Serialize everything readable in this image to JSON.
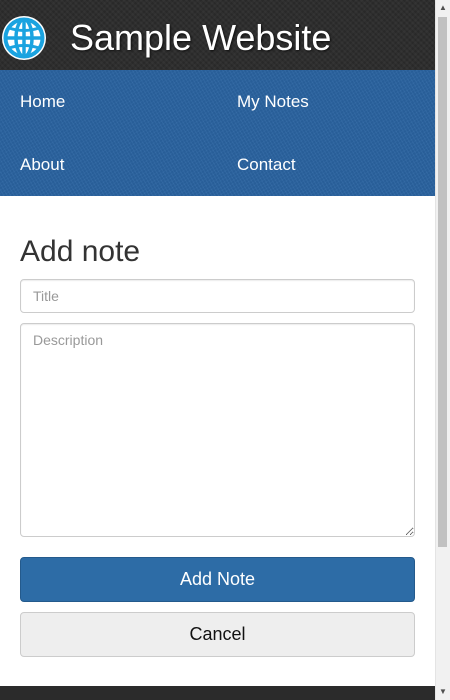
{
  "header": {
    "title": "Sample Website",
    "logo_icon": "globe-icon",
    "logo_color": "#1aa3e0"
  },
  "nav": {
    "items": [
      {
        "label": "Home"
      },
      {
        "label": "My Notes"
      },
      {
        "label": "About"
      },
      {
        "label": "Contact"
      }
    ]
  },
  "form": {
    "heading": "Add note",
    "title_placeholder": "Title",
    "title_value": "",
    "description_placeholder": "Description",
    "description_value": "",
    "submit_label": "Add Note",
    "cancel_label": "Cancel"
  },
  "colors": {
    "header_bg": "#2b2b2b",
    "nav_bg": "#2a63a0",
    "primary_button": "#2d6ca6",
    "default_button": "#eeeeee"
  },
  "scrollbar": {
    "up_icon": "scroll-up-arrow-icon",
    "down_icon": "scroll-down-arrow-icon"
  }
}
